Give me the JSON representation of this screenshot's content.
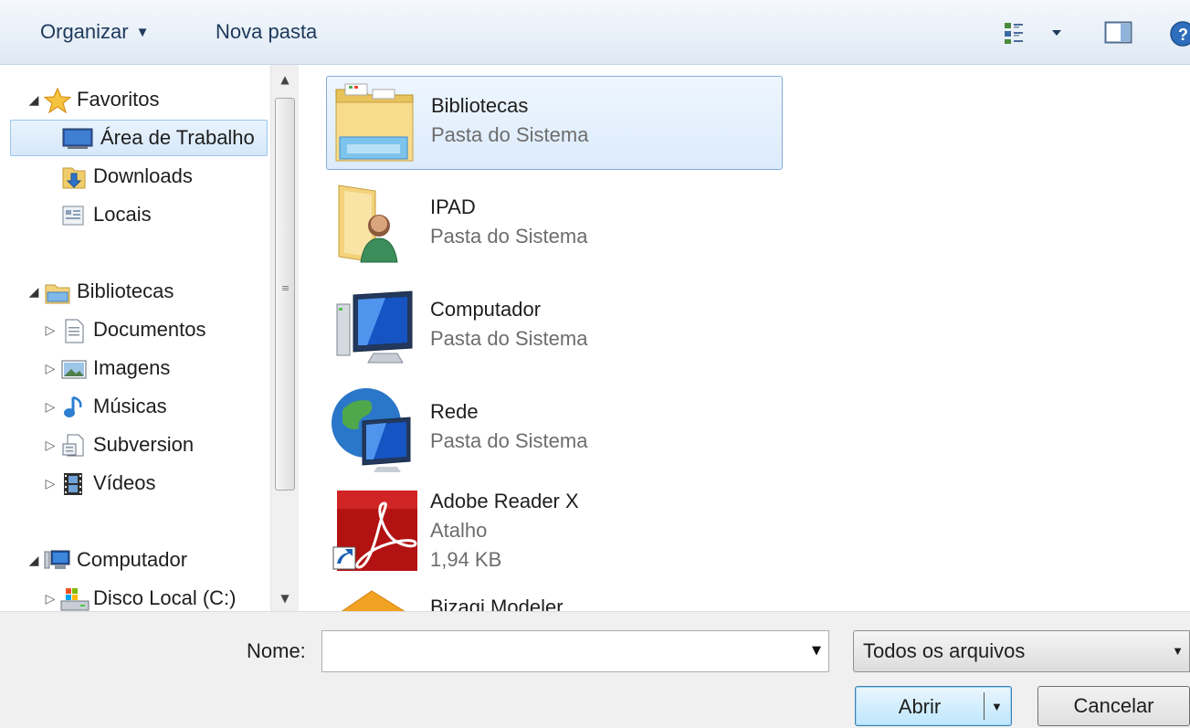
{
  "toolbar": {
    "organize_label": "Organizar",
    "new_folder_label": "Nova pasta"
  },
  "nav": {
    "favorites": {
      "label": "Favoritos",
      "items": [
        "Área de Trabalho",
        "Downloads",
        "Locais"
      ]
    },
    "libraries": {
      "label": "Bibliotecas",
      "items": [
        "Documentos",
        "Imagens",
        "Músicas",
        "Subversion",
        "Vídeos"
      ]
    },
    "computer": {
      "label": "Computador",
      "items": [
        "Disco Local (C:)"
      ]
    }
  },
  "files": [
    {
      "name": "Bibliotecas",
      "type": "Pasta do Sistema"
    },
    {
      "name": "IPAD",
      "type": "Pasta do Sistema"
    },
    {
      "name": "Computador",
      "type": "Pasta do Sistema"
    },
    {
      "name": "Rede",
      "type": "Pasta do Sistema"
    },
    {
      "name": "Adobe Reader X",
      "type": "Atalho",
      "size": "1,94 KB"
    },
    {
      "name": "Bizagi Modeler"
    }
  ],
  "bottom": {
    "name_label": "Nome:",
    "name_value": "",
    "filter_value": "Todos os arquivos",
    "open_label": "Abrir",
    "cancel_label": "Cancelar"
  },
  "colors": {
    "selection_border": "#84acdd",
    "toolbar_text": "#1e395b"
  }
}
